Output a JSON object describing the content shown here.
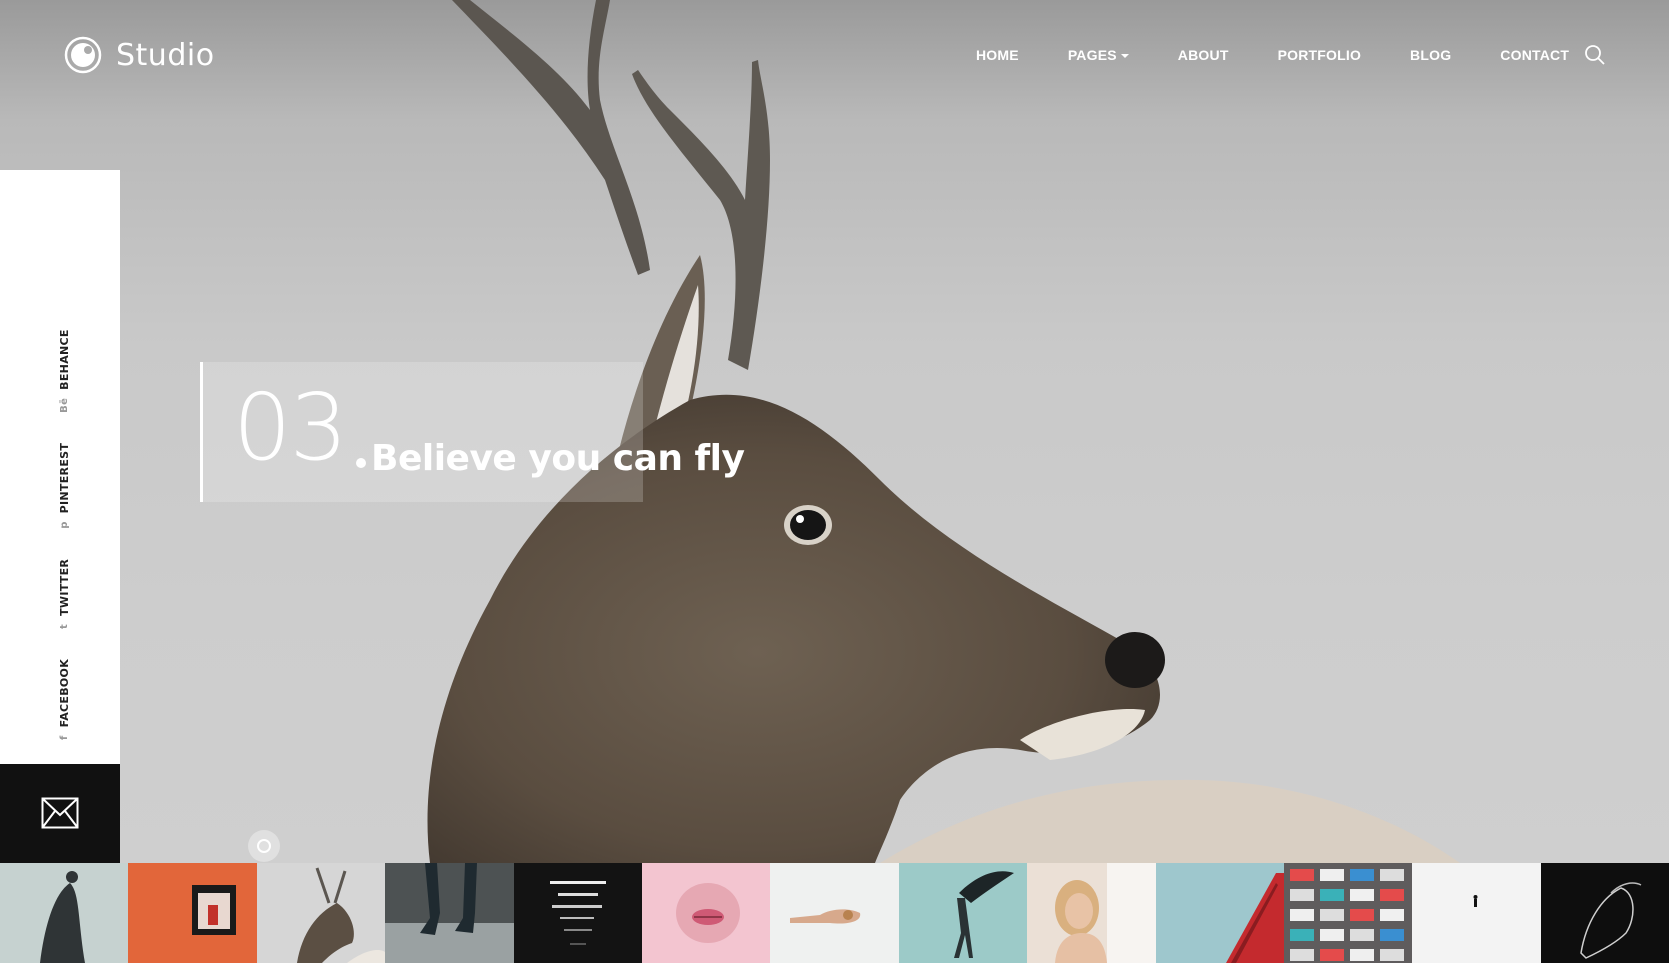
{
  "brand": {
    "name": "Studio"
  },
  "nav": {
    "items": [
      {
        "label": "HOME"
      },
      {
        "label": "PAGES",
        "has_dropdown": true
      },
      {
        "label": "ABOUT"
      },
      {
        "label": "PORTFOLIO"
      },
      {
        "label": "BLOG"
      },
      {
        "label": "CONTACT"
      }
    ],
    "search_icon": "search-icon"
  },
  "social": {
    "items": [
      {
        "label": "FACEBOOK",
        "icon": "f"
      },
      {
        "label": "TWITTER",
        "icon": "t"
      },
      {
        "label": "PINTEREST",
        "icon": "p"
      },
      {
        "label": "BEHANCE",
        "icon": "Bē"
      }
    ],
    "mail_icon": "mail-icon"
  },
  "hero": {
    "slide_number": "03",
    "caption": "Believe you can fly"
  },
  "thumbnails": [
    {
      "name": "dancer-fog",
      "bg": "#c7d3d1"
    },
    {
      "name": "red-wall-window",
      "bg": "#e2663a"
    },
    {
      "name": "deer",
      "bg": "#d5d5d5"
    },
    {
      "name": "jumping-legs",
      "bg": "#4c5152"
    },
    {
      "name": "light-lines",
      "bg": "#141414"
    },
    {
      "name": "pink-lips",
      "bg": "#f2c3cf"
    },
    {
      "name": "hand",
      "bg": "#eef0ef"
    },
    {
      "name": "wind-cloth",
      "bg": "#9ccac7"
    },
    {
      "name": "woman-curtain",
      "bg": "#ecdfd5"
    },
    {
      "name": "red-building",
      "bg": "#9cc6cc"
    },
    {
      "name": "balconies",
      "bg": "#6d6a6b"
    },
    {
      "name": "snow-walker",
      "bg": "#f4f4f4"
    },
    {
      "name": "dark-portrait",
      "bg": "#0e0e0e"
    }
  ],
  "colors": {
    "accent": "#ffffff",
    "panel": "#ffffff",
    "mail_panel": "#111111"
  }
}
